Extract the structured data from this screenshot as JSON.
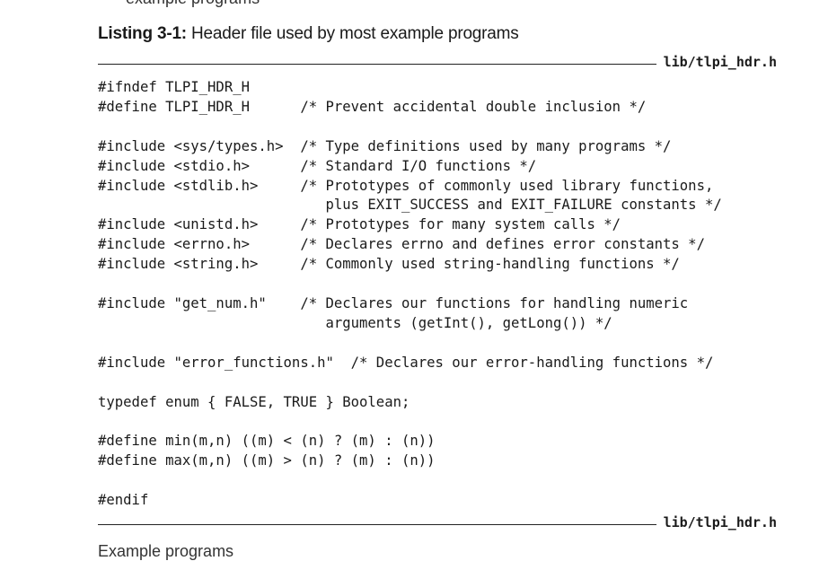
{
  "fragments": {
    "top": "example programs",
    "bottom": "Example programs"
  },
  "caption": {
    "label": "Listing 3-1:",
    "text": " Header file used by most example programs"
  },
  "file": {
    "top_label": "lib/tlpi_hdr.h",
    "bottom_label": "lib/tlpi_hdr.h"
  },
  "code": {
    "lines": [
      "#ifndef TLPI_HDR_H",
      "#define TLPI_HDR_H      /* Prevent accidental double inclusion */",
      "",
      "#include <sys/types.h>  /* Type definitions used by many programs */",
      "#include <stdio.h>      /* Standard I/O functions */",
      "#include <stdlib.h>     /* Prototypes of commonly used library functions,",
      "                           plus EXIT_SUCCESS and EXIT_FAILURE constants */",
      "#include <unistd.h>     /* Prototypes for many system calls */",
      "#include <errno.h>      /* Declares errno and defines error constants */",
      "#include <string.h>     /* Commonly used string-handling functions */",
      "",
      "#include \"get_num.h\"    /* Declares our functions for handling numeric",
      "                           arguments (getInt(), getLong()) */",
      "",
      "#include \"error_functions.h\"  /* Declares our error-handling functions */",
      "",
      "typedef enum { FALSE, TRUE } Boolean;",
      "",
      "#define min(m,n) ((m) < (n) ? (m) : (n))",
      "#define max(m,n) ((m) > (n) ? (m) : (n))",
      "",
      "#endif"
    ]
  }
}
